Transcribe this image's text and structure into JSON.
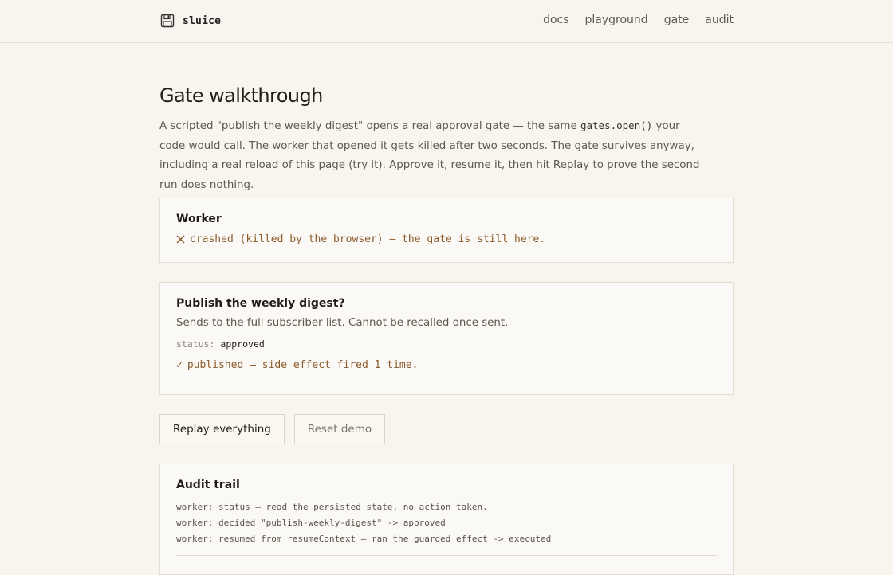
{
  "brand": {
    "name": "sluice",
    "icon": "floppy-disk-icon"
  },
  "nav": {
    "items": [
      {
        "label": "docs"
      },
      {
        "label": "playground"
      },
      {
        "label": "gate"
      },
      {
        "label": "audit"
      }
    ]
  },
  "page": {
    "title": "Gate walkthrough",
    "intro": {
      "part1": "A scripted \"publish the weekly digest\" opens a real approval gate — the same ",
      "code": "gates.open()",
      "part2": " your code would call. The worker that opened it gets killed after two seconds. The gate survives anyway, including a real reload of this page (try it). Approve it, resume it, then hit Replay to prove the second run does nothing."
    }
  },
  "worker": {
    "title": "Worker",
    "status_icon": "x-icon",
    "status": "crashed (killed by the browser) — the gate is still here."
  },
  "gate": {
    "title": "Publish the weekly digest?",
    "description": "Sends to the full subscriber list. Cannot be recalled once sent.",
    "status_label": "status:",
    "status_value": "approved",
    "result_icon": "check-icon",
    "result_mark": "✓",
    "result": "published — side effect fired 1 time."
  },
  "actions": {
    "replay_label": "Replay everything",
    "reset_label": "Reset demo"
  },
  "audit": {
    "title": "Audit trail",
    "entries": [
      "worker: status — read the persisted state, no action taken.",
      "worker: decided \"publish-weekly-digest\" -> approved",
      "worker: resumed from resumeContext — ran the guarded effect -> executed"
    ]
  },
  "colors": {
    "background": "#f8f5ef",
    "accent": "#8a5a2b",
    "border": "#e3ddd2"
  }
}
